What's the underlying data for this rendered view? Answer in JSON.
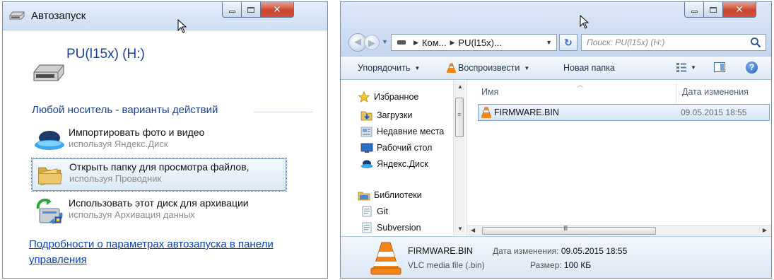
{
  "autoplay": {
    "title": "Автозапуск",
    "drive_name": "PU(l15x) (H:)",
    "section_heading": "Любой носитель - варианты действий",
    "actions": [
      {
        "title": "Импортировать фото и видео",
        "subtitle": "используя Яндекс.Диск",
        "icon": "yandex-disk-icon"
      },
      {
        "title": "Открыть папку для просмотра файлов,",
        "subtitle": "используя Проводник",
        "icon": "folder-icon",
        "selected": true
      },
      {
        "title": "Использовать этот диск для архивации",
        "subtitle": "используя Архивация данных",
        "icon": "backup-icon"
      }
    ],
    "footer_link": "Подробности о параметрах автозапуска в панели управления"
  },
  "explorer": {
    "address": {
      "crumbs": [
        "Ком...",
        "PU(l15x)..."
      ]
    },
    "search_placeholder": "Поиск: PU(l15x) (H:)",
    "toolbar": {
      "organize": "Упорядочить",
      "play": "Воспроизвести",
      "new_folder": "Новая папка"
    },
    "nav": {
      "favorites": "Избранное",
      "items": [
        "Загрузки",
        "Недавние места",
        "Рабочий стол",
        "Яндекс.Диск"
      ],
      "libraries": "Библиотеки",
      "lib_items": [
        "Git",
        "Subversion"
      ]
    },
    "columns": {
      "name": "Имя",
      "modified": "Дата изменения"
    },
    "files": [
      {
        "name": "FIRMWARE.BIN",
        "modified": "09.05.2015 18:55"
      }
    ],
    "scroll_glyph": "III",
    "details": {
      "name": "FIRMWARE.BIN",
      "type": "VLC media file (.bin)",
      "modified_label": "Дата изменения:",
      "modified_value": "09.05.2015 18:55",
      "size_label": "Размер:",
      "size_value": "100 КБ"
    }
  },
  "colors": {
    "accent_link": "#0a44b8",
    "heading_blue": "#1b3f93",
    "selection_border": "#7da2ce",
    "close_button": "#c9462c"
  }
}
